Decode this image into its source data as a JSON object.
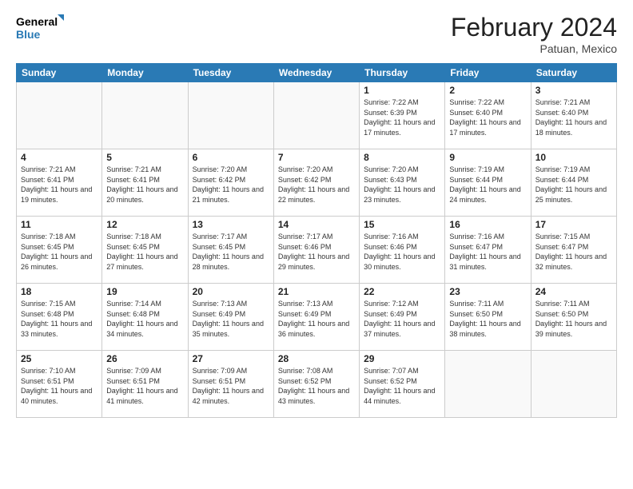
{
  "header": {
    "logo_line1": "General",
    "logo_line2": "Blue",
    "month_year": "February 2024",
    "location": "Patuan, Mexico"
  },
  "days_of_week": [
    "Sunday",
    "Monday",
    "Tuesday",
    "Wednesday",
    "Thursday",
    "Friday",
    "Saturday"
  ],
  "weeks": [
    [
      {
        "num": "",
        "info": ""
      },
      {
        "num": "",
        "info": ""
      },
      {
        "num": "",
        "info": ""
      },
      {
        "num": "",
        "info": ""
      },
      {
        "num": "1",
        "info": "Sunrise: 7:22 AM\nSunset: 6:39 PM\nDaylight: 11 hours and 17 minutes."
      },
      {
        "num": "2",
        "info": "Sunrise: 7:22 AM\nSunset: 6:40 PM\nDaylight: 11 hours and 17 minutes."
      },
      {
        "num": "3",
        "info": "Sunrise: 7:21 AM\nSunset: 6:40 PM\nDaylight: 11 hours and 18 minutes."
      }
    ],
    [
      {
        "num": "4",
        "info": "Sunrise: 7:21 AM\nSunset: 6:41 PM\nDaylight: 11 hours and 19 minutes."
      },
      {
        "num": "5",
        "info": "Sunrise: 7:21 AM\nSunset: 6:41 PM\nDaylight: 11 hours and 20 minutes."
      },
      {
        "num": "6",
        "info": "Sunrise: 7:20 AM\nSunset: 6:42 PM\nDaylight: 11 hours and 21 minutes."
      },
      {
        "num": "7",
        "info": "Sunrise: 7:20 AM\nSunset: 6:42 PM\nDaylight: 11 hours and 22 minutes."
      },
      {
        "num": "8",
        "info": "Sunrise: 7:20 AM\nSunset: 6:43 PM\nDaylight: 11 hours and 23 minutes."
      },
      {
        "num": "9",
        "info": "Sunrise: 7:19 AM\nSunset: 6:44 PM\nDaylight: 11 hours and 24 minutes."
      },
      {
        "num": "10",
        "info": "Sunrise: 7:19 AM\nSunset: 6:44 PM\nDaylight: 11 hours and 25 minutes."
      }
    ],
    [
      {
        "num": "11",
        "info": "Sunrise: 7:18 AM\nSunset: 6:45 PM\nDaylight: 11 hours and 26 minutes."
      },
      {
        "num": "12",
        "info": "Sunrise: 7:18 AM\nSunset: 6:45 PM\nDaylight: 11 hours and 27 minutes."
      },
      {
        "num": "13",
        "info": "Sunrise: 7:17 AM\nSunset: 6:45 PM\nDaylight: 11 hours and 28 minutes."
      },
      {
        "num": "14",
        "info": "Sunrise: 7:17 AM\nSunset: 6:46 PM\nDaylight: 11 hours and 29 minutes."
      },
      {
        "num": "15",
        "info": "Sunrise: 7:16 AM\nSunset: 6:46 PM\nDaylight: 11 hours and 30 minutes."
      },
      {
        "num": "16",
        "info": "Sunrise: 7:16 AM\nSunset: 6:47 PM\nDaylight: 11 hours and 31 minutes."
      },
      {
        "num": "17",
        "info": "Sunrise: 7:15 AM\nSunset: 6:47 PM\nDaylight: 11 hours and 32 minutes."
      }
    ],
    [
      {
        "num": "18",
        "info": "Sunrise: 7:15 AM\nSunset: 6:48 PM\nDaylight: 11 hours and 33 minutes."
      },
      {
        "num": "19",
        "info": "Sunrise: 7:14 AM\nSunset: 6:48 PM\nDaylight: 11 hours and 34 minutes."
      },
      {
        "num": "20",
        "info": "Sunrise: 7:13 AM\nSunset: 6:49 PM\nDaylight: 11 hours and 35 minutes."
      },
      {
        "num": "21",
        "info": "Sunrise: 7:13 AM\nSunset: 6:49 PM\nDaylight: 11 hours and 36 minutes."
      },
      {
        "num": "22",
        "info": "Sunrise: 7:12 AM\nSunset: 6:49 PM\nDaylight: 11 hours and 37 minutes."
      },
      {
        "num": "23",
        "info": "Sunrise: 7:11 AM\nSunset: 6:50 PM\nDaylight: 11 hours and 38 minutes."
      },
      {
        "num": "24",
        "info": "Sunrise: 7:11 AM\nSunset: 6:50 PM\nDaylight: 11 hours and 39 minutes."
      }
    ],
    [
      {
        "num": "25",
        "info": "Sunrise: 7:10 AM\nSunset: 6:51 PM\nDaylight: 11 hours and 40 minutes."
      },
      {
        "num": "26",
        "info": "Sunrise: 7:09 AM\nSunset: 6:51 PM\nDaylight: 11 hours and 41 minutes."
      },
      {
        "num": "27",
        "info": "Sunrise: 7:09 AM\nSunset: 6:51 PM\nDaylight: 11 hours and 42 minutes."
      },
      {
        "num": "28",
        "info": "Sunrise: 7:08 AM\nSunset: 6:52 PM\nDaylight: 11 hours and 43 minutes."
      },
      {
        "num": "29",
        "info": "Sunrise: 7:07 AM\nSunset: 6:52 PM\nDaylight: 11 hours and 44 minutes."
      },
      {
        "num": "",
        "info": ""
      },
      {
        "num": "",
        "info": ""
      }
    ]
  ]
}
